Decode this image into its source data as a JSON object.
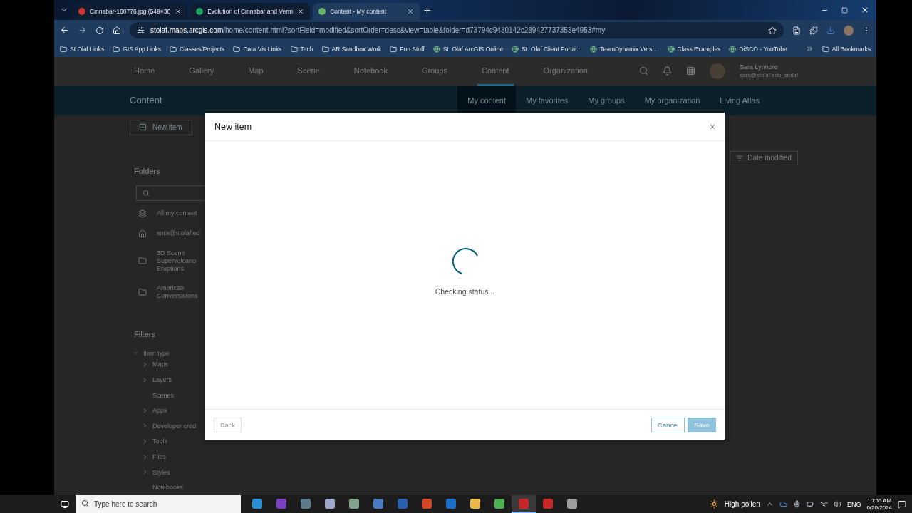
{
  "browser": {
    "tabs": [
      {
        "title": "Cinnabar-180776.jpg (549×30",
        "selected": false
      },
      {
        "title": "Evolution of Cinnabar and Verm",
        "selected": false
      },
      {
        "title": "Content - My content",
        "selected": true
      }
    ],
    "address": {
      "domain": "stolaf.maps.arcgis.com",
      "path": "/home/content.html?sortField=modified&sortOrder=desc&view=table&folder=d73794c9430142c289427737353e4953#my"
    },
    "bookmarks": [
      {
        "label": "St Olaf Links",
        "kind": "folder"
      },
      {
        "label": "GIS App Links",
        "kind": "folder"
      },
      {
        "label": "Classes/Projects",
        "kind": "folder"
      },
      {
        "label": "Data Vis Links",
        "kind": "folder"
      },
      {
        "label": "Tech",
        "kind": "folder"
      },
      {
        "label": "AR Sandbox Work",
        "kind": "folder"
      },
      {
        "label": "Fun Stuff",
        "kind": "folder"
      },
      {
        "label": "St. Olaf ArcGIS Online",
        "kind": "site"
      },
      {
        "label": "St. Olaf Client Portal...",
        "kind": "site"
      },
      {
        "label": "TeamDynamix Versi...",
        "kind": "site"
      },
      {
        "label": "Class Examples",
        "kind": "site"
      },
      {
        "label": "DiSCO - YouTube",
        "kind": "site"
      }
    ],
    "all_bookmarks": "All Bookmarks"
  },
  "app": {
    "nav": [
      {
        "label": "Home",
        "selected": false
      },
      {
        "label": "Gallery",
        "selected": false
      },
      {
        "label": "Map",
        "selected": false
      },
      {
        "label": "Scene",
        "selected": false
      },
      {
        "label": "Notebook",
        "selected": false
      },
      {
        "label": "Groups",
        "selected": false
      },
      {
        "label": "Content",
        "selected": true
      },
      {
        "label": "Organization",
        "selected": false
      }
    ],
    "user": {
      "name": "Sara Lynnore",
      "email": "sara@stolaf.edu_stolaf"
    },
    "header": {
      "title": "Content",
      "tabs": [
        {
          "label": "My content",
          "selected": true
        },
        {
          "label": "My favorites",
          "selected": false
        },
        {
          "label": "My groups",
          "selected": false
        },
        {
          "label": "My organization",
          "selected": false
        },
        {
          "label": "Living Atlas",
          "selected": false
        }
      ]
    },
    "new_item_button": "New item",
    "folders": {
      "heading": "Folders",
      "items": [
        {
          "label": "All my content",
          "kind": "all"
        },
        {
          "label": "sara@stolaf.ed",
          "kind": "home"
        },
        {
          "label": "3D Scene Supervolcano Eruptions",
          "kind": "folder"
        },
        {
          "label": "American Conversations",
          "kind": "folder"
        }
      ]
    },
    "filters": {
      "heading": "Filters",
      "group": {
        "label": "Item type",
        "expanded": true,
        "children": [
          {
            "label": "Maps",
            "expandable": true
          },
          {
            "label": "Layers",
            "expandable": true
          },
          {
            "label": "Scenes",
            "expandable": false
          },
          {
            "label": "Apps",
            "expandable": true
          },
          {
            "label": "Developer cred",
            "expandable": true
          },
          {
            "label": "Tools",
            "expandable": true
          },
          {
            "label": "Files",
            "expandable": true
          },
          {
            "label": "Styles",
            "expandable": true
          },
          {
            "label": "Notebooks",
            "expandable": false
          }
        ]
      }
    },
    "sort_button": "Date modified"
  },
  "dialog": {
    "title": "New item",
    "status": "Checking status...",
    "buttons": [
      {
        "label": "Back",
        "kind": "secondary",
        "disabled": true
      },
      {
        "label": "Cancel",
        "kind": "secondary",
        "disabled": false
      },
      {
        "label": "Save",
        "kind": "primary",
        "disabled": true
      }
    ]
  },
  "taskbar": {
    "search_placeholder": "Type here to search",
    "apps": [
      {
        "active": false
      },
      {
        "active": false
      },
      {
        "active": false
      },
      {
        "active": false
      },
      {
        "active": false
      },
      {
        "active": false
      },
      {
        "active": false
      },
      {
        "active": false
      },
      {
        "active": false
      },
      {
        "active": false
      },
      {
        "active": false
      },
      {
        "active": true
      },
      {
        "active": false
      },
      {
        "active": false
      }
    ],
    "weather": "High pollen",
    "language": "ENG",
    "time": "10:56 AM",
    "date": "6/20/2024"
  }
}
